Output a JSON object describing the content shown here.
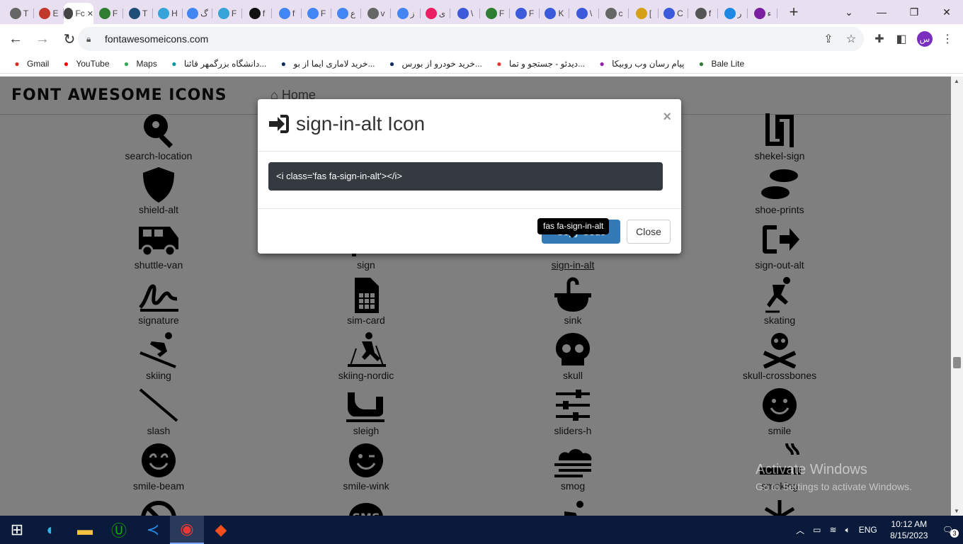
{
  "tabs": [
    {
      "label": "T",
      "icon": "globe-icon",
      "color": "#666"
    },
    {
      "label": "E",
      "icon": "mail-badge-icon",
      "color": "#c0392b"
    },
    {
      "label": "Fc",
      "icon": "fa-icon",
      "color": "#444",
      "active": true
    },
    {
      "label": "F",
      "icon": "w-icon",
      "color": "#2e7d32"
    },
    {
      "label": "T",
      "icon": "t-icon",
      "color": "#1f4e79"
    },
    {
      "label": "H",
      "icon": "tilde-icon",
      "color": "#36a3d9"
    },
    {
      "label": "گ",
      "icon": "google-icon",
      "color": "#4285f4"
    },
    {
      "label": "F",
      "icon": "tilde-icon",
      "color": "#36a3d9"
    },
    {
      "label": "f",
      "icon": "m-icon",
      "color": "#111"
    },
    {
      "label": "f",
      "icon": "google-icon",
      "color": "#4285f4"
    },
    {
      "label": "F",
      "icon": "google-icon",
      "color": "#4285f4"
    },
    {
      "label": "ع",
      "icon": "google-icon",
      "color": "#4285f4"
    },
    {
      "label": "v",
      "icon": "globe-icon",
      "color": "#666"
    },
    {
      "label": "ز",
      "icon": "google-icon",
      "color": "#4285f4"
    },
    {
      "label": "ی",
      "icon": "hex-icon",
      "color": "#e91e63"
    },
    {
      "label": "\\",
      "icon": "flag-icon",
      "color": "#3b5bdb"
    },
    {
      "label": "F",
      "icon": "person-icon",
      "color": "#2e7d32"
    },
    {
      "label": "F",
      "icon": "flag-icon",
      "color": "#3b5bdb"
    },
    {
      "label": "K",
      "icon": "flag-icon",
      "color": "#3b5bdb"
    },
    {
      "label": "\\",
      "icon": "flag-icon",
      "color": "#3b5bdb"
    },
    {
      "label": "c",
      "icon": "globe-icon",
      "color": "#666"
    },
    {
      "label": "[",
      "icon": "face-icon",
      "color": "#d4a017"
    },
    {
      "label": "C",
      "icon": "flag-icon",
      "color": "#3b5bdb"
    },
    {
      "label": "f",
      "icon": "chrome-icon",
      "color": "#555"
    },
    {
      "label": "ر",
      "icon": "hex-icon",
      "color": "#1e88e5"
    },
    {
      "label": "ء",
      "icon": "p-icon",
      "color": "#7b1fa2"
    }
  ],
  "browser": {
    "url": "fontawesomeicons.com",
    "profile_letter": "س"
  },
  "bookmarks": [
    {
      "label": "Gmail",
      "icon": "gmail-icon",
      "color": "#d93025"
    },
    {
      "label": "YouTube",
      "icon": "youtube-icon",
      "color": "#ff0000"
    },
    {
      "label": "Maps",
      "icon": "maps-pin-icon",
      "color": "#34a853"
    },
    {
      "label": "دانشگاه بزرگمهر قائنا...",
      "icon": "university-icon",
      "color": "#0097a7"
    },
    {
      "label": "خرید لاماری ایما از بو...",
      "icon": "car-brand-icon",
      "color": "#0d2b5c"
    },
    {
      "label": "خرید خودرو از بورس...",
      "icon": "car-brand-icon",
      "color": "#0d2b5c"
    },
    {
      "label": "دیدئو - جستجو و تما...",
      "icon": "video-icon",
      "color": "#e53935"
    },
    {
      "label": "پیام رسان وب روبیکا",
      "icon": "rubika-icon",
      "color": "#8e24aa"
    },
    {
      "label": "Bale Lite",
      "icon": "bale-icon",
      "color": "#2e7d32"
    }
  ],
  "site": {
    "logo": "FONT AWESOME ICONS",
    "home": "Home"
  },
  "icons": [
    {
      "label": "search-location",
      "icon": "search-location-icon"
    },
    {
      "label": "",
      "icon": ""
    },
    {
      "label": "",
      "icon": ""
    },
    {
      "label": "shekel-sign",
      "icon": "shekel-sign-icon"
    },
    {
      "label": "shield-alt",
      "icon": "shield-alt-icon"
    },
    {
      "label": "",
      "icon": ""
    },
    {
      "label": "",
      "icon": ""
    },
    {
      "label": "shoe-prints",
      "icon": "shoe-prints-icon"
    },
    {
      "label": "shuttle-van",
      "icon": "shuttle-van-icon"
    },
    {
      "label": "sign",
      "icon": "sign-icon"
    },
    {
      "label": "sign-in-alt",
      "icon": "sign-in-alt-icon"
    },
    {
      "label": "sign-out-alt",
      "icon": "sign-out-alt-icon"
    },
    {
      "label": "signature",
      "icon": "signature-icon"
    },
    {
      "label": "sim-card",
      "icon": "sim-card-icon"
    },
    {
      "label": "sink",
      "icon": "sink-icon"
    },
    {
      "label": "skating",
      "icon": "skating-icon"
    },
    {
      "label": "skiing",
      "icon": "skiing-icon"
    },
    {
      "label": "skiing-nordic",
      "icon": "skiing-nordic-icon"
    },
    {
      "label": "skull",
      "icon": "skull-icon"
    },
    {
      "label": "skull-crossbones",
      "icon": "skull-crossbones-icon"
    },
    {
      "label": "slash",
      "icon": "slash-icon"
    },
    {
      "label": "sleigh",
      "icon": "sleigh-icon"
    },
    {
      "label": "sliders-h",
      "icon": "sliders-h-icon"
    },
    {
      "label": "smile",
      "icon": "smile-icon"
    },
    {
      "label": "smile-beam",
      "icon": "smile-beam-icon"
    },
    {
      "label": "smile-wink",
      "icon": "smile-wink-icon"
    },
    {
      "label": "smog",
      "icon": "smog-icon"
    },
    {
      "label": "smoking",
      "icon": "smoking-icon"
    },
    {
      "label": "",
      "icon": "smoking-ban-icon"
    },
    {
      "label": "",
      "icon": "sms-icon"
    },
    {
      "label": "",
      "icon": "snowboarding-icon"
    },
    {
      "label": "",
      "icon": "snowflake-icon"
    }
  ],
  "modal": {
    "title": "sign-in-alt Icon",
    "code": "<i class='fas fa-sign-in-alt'></i>",
    "copy_label": "Copy Code",
    "close_label": "Close",
    "close_x": "×",
    "tooltip": "fas fa-sign-in-alt"
  },
  "watermark": {
    "line1": "Activate Windows",
    "line2": "Go to Settings to activate Windows."
  },
  "taskbar": {
    "apps": [
      "windows-start-icon",
      "edge-icon",
      "file-explorer-icon",
      "upwork-icon",
      "vscode-icon",
      "chrome-icon",
      "figma-icon"
    ],
    "language": "ENG",
    "time": "10:12 AM",
    "date": "8/15/2023",
    "notifications": "3"
  }
}
